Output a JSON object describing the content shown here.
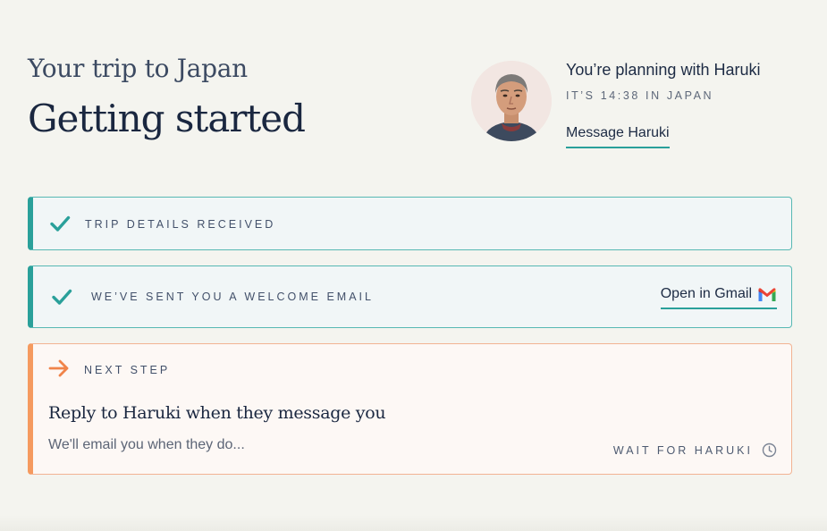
{
  "header": {
    "subtitle": "Your trip to Japan",
    "title": "Getting started"
  },
  "planner": {
    "avatar_icon": "person-avatar",
    "planning_text": "You’re planning with Haruki",
    "time_text": "IT’S 14:38 IN JAPAN",
    "message_link": "Message Haruki"
  },
  "steps": [
    {
      "status": "done",
      "icon": "check-icon",
      "label": "TRIP DETAILS RECEIVED"
    },
    {
      "status": "done",
      "icon": "check-icon",
      "label": "WE’VE SENT YOU A WELCOME EMAIL",
      "action": "Open in Gmail",
      "action_icon": "gmail-icon"
    }
  ],
  "next_step": {
    "icon": "arrow-right-icon",
    "label": "NEXT STEP",
    "heading": "Reply to Haruki when they message you",
    "note": "We'll email you when they do...",
    "wait_label": "WAIT FOR HARUKI",
    "wait_icon": "clock-icon"
  },
  "colors": {
    "background": "#f4f4ef",
    "teal_accent": "#2aa09a",
    "orange_accent": "#f59a5f",
    "navy_text": "#1a2740"
  }
}
